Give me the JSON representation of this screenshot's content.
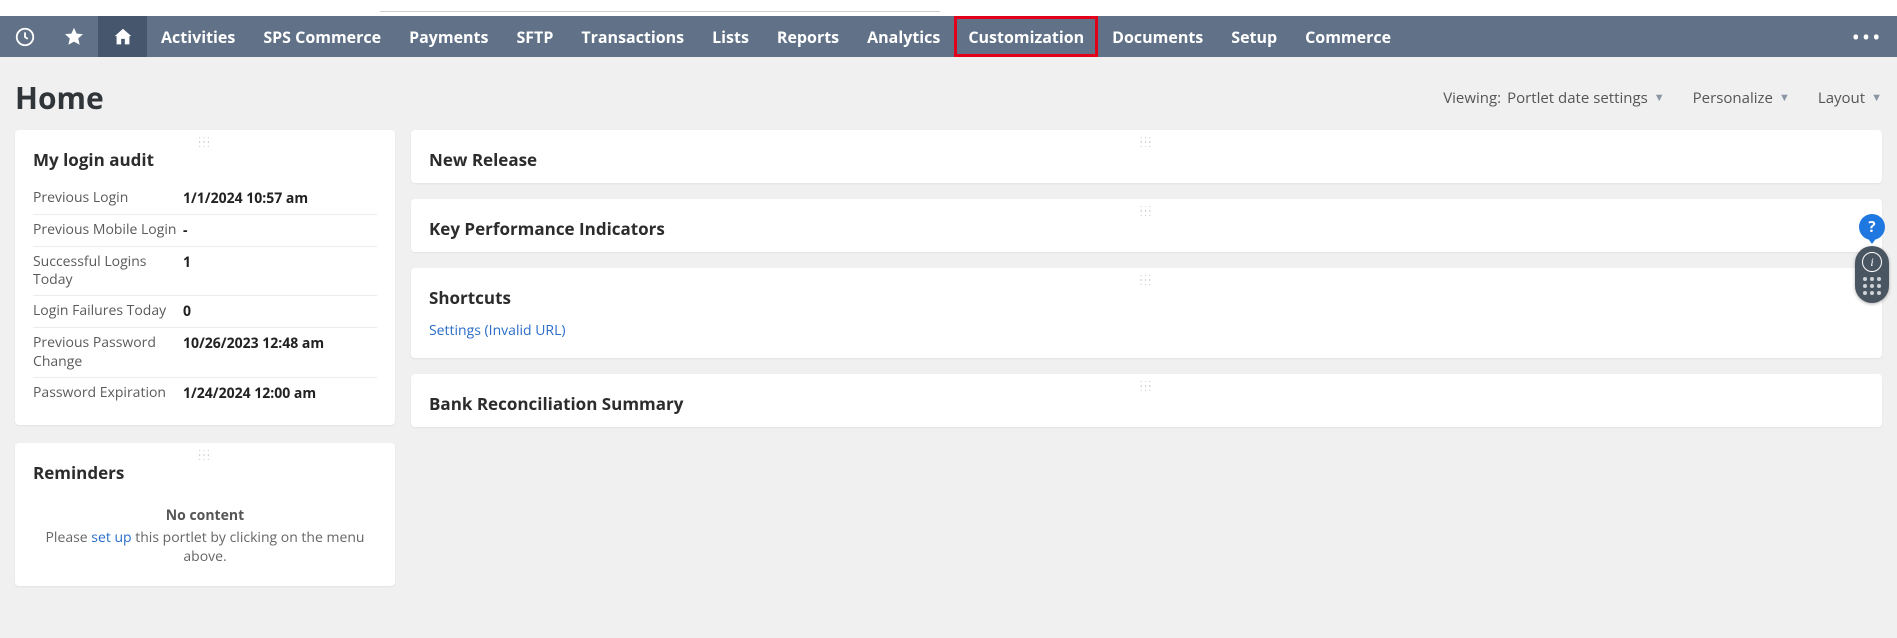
{
  "nav": {
    "items": [
      {
        "label": "Activities",
        "highlighted": false
      },
      {
        "label": "SPS Commerce",
        "highlighted": false
      },
      {
        "label": "Payments",
        "highlighted": false
      },
      {
        "label": "SFTP",
        "highlighted": false
      },
      {
        "label": "Transactions",
        "highlighted": false
      },
      {
        "label": "Lists",
        "highlighted": false
      },
      {
        "label": "Reports",
        "highlighted": false
      },
      {
        "label": "Analytics",
        "highlighted": false
      },
      {
        "label": "Customization",
        "highlighted": true
      },
      {
        "label": "Documents",
        "highlighted": false
      },
      {
        "label": "Setup",
        "highlighted": false
      },
      {
        "label": "Commerce",
        "highlighted": false
      }
    ]
  },
  "page": {
    "title": "Home"
  },
  "view_controls": {
    "viewing_prefix": "Viewing:",
    "viewing_value": "Portlet date settings",
    "personalize": "Personalize",
    "layout": "Layout"
  },
  "portlets": {
    "login_audit": {
      "title": "My login audit",
      "rows": [
        {
          "label": "Previous Login",
          "value": "1/1/2024 10:57 am"
        },
        {
          "label": "Previous Mobile Login",
          "value": "-"
        },
        {
          "label": "Successful Logins Today",
          "value": "1"
        },
        {
          "label": "Login Failures Today",
          "value": "0"
        },
        {
          "label": "Previous Password Change",
          "value": "10/26/2023 12:48 am"
        },
        {
          "label": "Password Expiration",
          "value": "1/24/2024 12:00 am"
        }
      ]
    },
    "reminders": {
      "title": "Reminders",
      "no_content": "No content",
      "please_prefix": "Please ",
      "setup_link": "set up",
      "please_suffix": " this portlet by clicking on the menu above."
    },
    "new_release": {
      "title": "New Release"
    },
    "kpi": {
      "title": "Key Performance Indicators"
    },
    "shortcuts": {
      "title": "Shortcuts",
      "link": "Settings (Invalid URL)"
    },
    "bank_recon": {
      "title": "Bank Reconciliation Summary"
    }
  }
}
